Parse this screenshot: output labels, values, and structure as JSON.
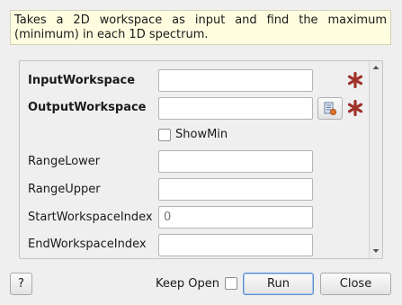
{
  "description": "Takes a 2D workspace as input and find the maximum (minimum) in each 1D spectrum.",
  "properties": [
    {
      "label": "InputWorkspace",
      "value": "",
      "required": true
    },
    {
      "label": "OutputWorkspace",
      "value": "",
      "required": true
    },
    {
      "label": "ShowMin",
      "checked": false
    },
    {
      "label": "RangeLower",
      "value": ""
    },
    {
      "label": "RangeUpper",
      "value": ""
    },
    {
      "label": "StartWorkspaceIndex",
      "placeholder": "0"
    },
    {
      "label": "EndWorkspaceIndex",
      "value": ""
    }
  ],
  "footer": {
    "help_label": "?",
    "keep_open_label": "Keep Open",
    "keep_open_checked": false,
    "run_label": "Run",
    "close_label": "Close"
  },
  "icons": {
    "required": "asterisk-icon",
    "browse": "workspace-browse-icon"
  },
  "colors": {
    "required_star": "#a0322a",
    "description_bg": "#fefde0",
    "default_button_border": "#5b8fcf"
  }
}
